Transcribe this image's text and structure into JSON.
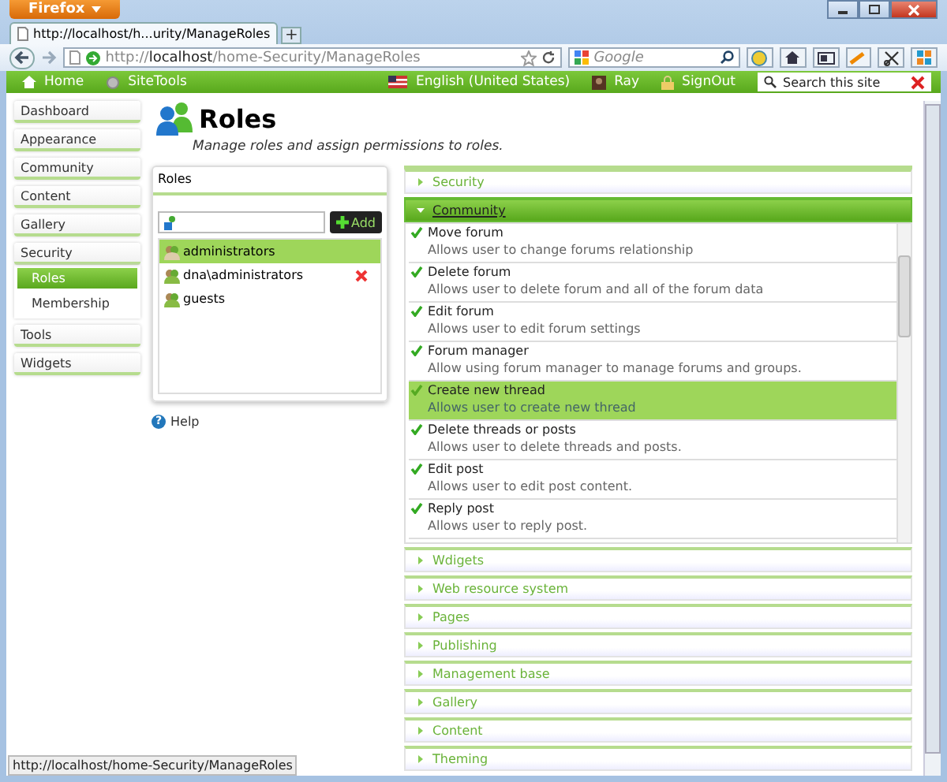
{
  "browser": {
    "app_button": "Firefox",
    "tab_title": "http://localhost/h...urity/ManageRoles",
    "new_tab": "+",
    "url_prefix": "http://",
    "url_host": "localhost",
    "url_path": "/home-Security/ManageRoles",
    "search_placeholder": "Google"
  },
  "site_bar": {
    "links": [
      {
        "kind": "home",
        "label": "Home"
      },
      {
        "kind": "tools",
        "label": "SiteTools"
      },
      {
        "kind": "flag",
        "label": "English (United States)"
      },
      {
        "kind": "user",
        "label": "Ray"
      },
      {
        "kind": "lock",
        "label": "SignOut"
      }
    ],
    "search_placeholder": "Search this site"
  },
  "sidebar": {
    "items": [
      {
        "label": "Dashboard",
        "selected": false
      },
      {
        "label": "Appearance",
        "selected": false
      },
      {
        "label": "Community",
        "selected": false
      },
      {
        "label": "Content",
        "selected": false
      },
      {
        "label": "Gallery",
        "selected": false
      },
      {
        "label": "Security",
        "selected": false,
        "children": [
          {
            "label": "Roles",
            "selected": true
          },
          {
            "label": "Membership",
            "selected": false
          }
        ]
      },
      {
        "label": "Tools",
        "selected": false
      },
      {
        "label": "Widgets",
        "selected": false
      }
    ]
  },
  "page": {
    "title": "Roles",
    "subtitle": "Manage roles and assign permissions to roles."
  },
  "roles_panel": {
    "title": "Roles",
    "add_button": "Add",
    "roles": [
      {
        "name": "administrators",
        "selected": true,
        "deletable": false
      },
      {
        "name": "dna\\administrators",
        "selected": false,
        "deletable": true
      },
      {
        "name": "guests",
        "selected": false,
        "deletable": false
      }
    ]
  },
  "help": "Help",
  "help_icon": "?",
  "permission_groups": [
    {
      "label": "Security",
      "expanded": false
    },
    {
      "label": "Community",
      "expanded": true,
      "permissions": [
        {
          "name": "Move forum",
          "description": "Allows user to change forums relationship",
          "checked": true,
          "selected": false
        },
        {
          "name": "Delete forum",
          "description": "Allows user to delete forum and all of the forum data",
          "checked": true,
          "selected": false
        },
        {
          "name": "Edit forum",
          "description": "Allows user to edit forum settings",
          "checked": true,
          "selected": false
        },
        {
          "name": "Forum manager",
          "description": "Allow using forum manager to manage forums and groups.",
          "checked": true,
          "selected": false
        },
        {
          "name": "Create new thread",
          "description": "Allows user to create new thread",
          "checked": true,
          "selected": true
        },
        {
          "name": "Delete threads or posts",
          "description": "Allows user to delete threads and posts.",
          "checked": true,
          "selected": false
        },
        {
          "name": "Edit post",
          "description": "Allows user to edit post content.",
          "checked": true,
          "selected": false
        },
        {
          "name": "Reply post",
          "description": "Allows user to reply post.",
          "checked": true,
          "selected": false
        }
      ]
    },
    {
      "label": "Wdigets",
      "expanded": false
    },
    {
      "label": "Web resource system",
      "expanded": false
    },
    {
      "label": "Pages",
      "expanded": false
    },
    {
      "label": "Publishing",
      "expanded": false
    },
    {
      "label": "Management base",
      "expanded": false
    },
    {
      "label": "Gallery",
      "expanded": false
    },
    {
      "label": "Content",
      "expanded": false
    },
    {
      "label": "Theming",
      "expanded": false
    }
  ],
  "status_bar": "http://localhost/home-Security/ManageRoles"
}
